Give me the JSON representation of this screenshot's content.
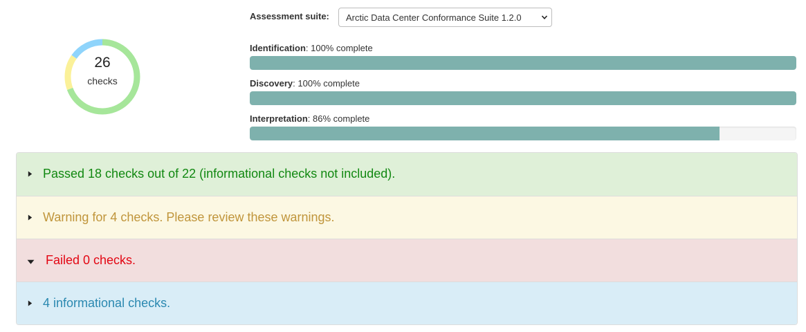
{
  "summary": {
    "total_checks": "26",
    "checks_label": "checks",
    "ring_segments": [
      {
        "name": "passed",
        "value": 18,
        "color": "#a6e69a"
      },
      {
        "name": "warnings",
        "value": 4,
        "color": "#fbf199"
      },
      {
        "name": "failed",
        "value": 0,
        "color": "#f4a3a3"
      },
      {
        "name": "informational",
        "value": 4,
        "color": "#8fd4fb"
      }
    ]
  },
  "suite": {
    "label": "Assessment suite:",
    "selected": "Arctic Data Center Conformance Suite 1.2.0"
  },
  "progress": [
    {
      "name": "Identification",
      "suffix": ": 100% complete",
      "percent": 100
    },
    {
      "name": "Discovery",
      "suffix": ": 100% complete",
      "percent": 100
    },
    {
      "name": "Interpretation",
      "suffix": ": 86% complete",
      "percent": 86
    }
  ],
  "colors": {
    "bar": "#7eb1ad"
  },
  "results": [
    {
      "type": "pass",
      "text": "Passed 18 checks out of 22 (informational checks not included).",
      "expanded": false
    },
    {
      "type": "warn",
      "text": "Warning for 4 checks. Please review these warnings.",
      "expanded": false
    },
    {
      "type": "fail",
      "text": "Failed 0 checks.",
      "expanded": true
    },
    {
      "type": "info",
      "text": "4 informational checks.",
      "expanded": false
    }
  ]
}
